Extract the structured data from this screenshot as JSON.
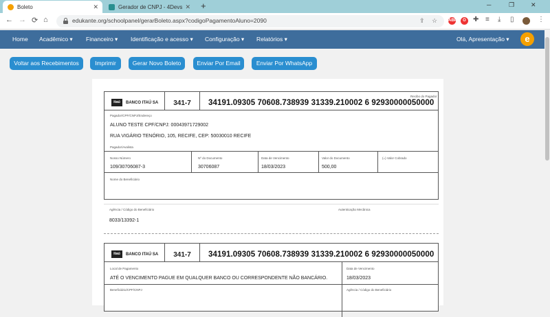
{
  "browser": {
    "tabs": [
      {
        "label": "Boleto",
        "active": true
      },
      {
        "label": "Gerador de CNPJ - 4Devs",
        "active": false
      }
    ],
    "new_tab": "+",
    "address": "edukante.org/schoolpanel/gerarBoleto.aspx?codigoPagamentoAluno=2090",
    "window_controls": {
      "minimize": "─",
      "restore": "❐",
      "close": "✕"
    },
    "extensions": {
      "adblock": "ABP",
      "opera": "O"
    }
  },
  "nav": {
    "items": [
      {
        "label": "Home"
      },
      {
        "label": "Acadêmico ▾"
      },
      {
        "label": "Financeiro ▾"
      },
      {
        "label": "Identificação e acesso ▾"
      },
      {
        "label": "Configuração ▾"
      },
      {
        "label": "Relatórios ▾"
      }
    ],
    "user": "Olá, Apresentação ▾",
    "logo_letter": "e"
  },
  "actions": [
    {
      "label": "Voltar aos Recebimentos"
    },
    {
      "label": "Imprimir"
    },
    {
      "label": "Gerar Novo Boleto"
    },
    {
      "label": "Enviar Por Email"
    },
    {
      "label": "Enviar Por WhatsApp"
    }
  ],
  "boleto": {
    "logo_text": "itaú",
    "bank_name": "BANCO ITAÚ SA",
    "bank_code": "341-7",
    "linha_digitavel": "34191.09305  70608.738939  31339.210002  6  92930000050000",
    "recibo_label": "Recibo do Pagador",
    "pagador_label": "Pagador/CPF/CNPJ/Endereço",
    "pagador_nome": "ALUNO TESTE  CPF/CNPJ: 00043971729002",
    "pagador_endereco": "RUA VIGÁRIO TENÓRIO, 105, RECIFE, CEP: 50030010 RECIFE",
    "avalista_label": "Pagador/Avalista",
    "fields": [
      {
        "label": "Nosso Número",
        "value": "109/30706087-3"
      },
      {
        "label": "Nº do Documento",
        "value": "30706087"
      },
      {
        "label": "Data de Vencimento",
        "value": "18/03/2023"
      },
      {
        "label": "Valor do Documento",
        "value": "500,00"
      },
      {
        "label": "(=) Valor Cobrado",
        "value": ""
      }
    ],
    "beneficiario_label": "Nome do Beneficiário",
    "agencia_label": "Agência / Código do Beneficiário",
    "agencia_value": "8033/13392-1",
    "autenticacao_label": "Autenticação Mecânica",
    "local_label": "Local de Pagamento",
    "local_value": "ATÉ O VENCIMENTO PAGUE EM QUALQUER BANCO OU CORRESPONDENTE NÃO BANCÁRIO.",
    "vencimento_label": "Data de Vencimento",
    "vencimento_value": "18/03/2023",
    "beneficiario2_label": "Beneficiário/CPF/CNPJ",
    "agencia2_label": "Agência / Código do Beneficiário"
  },
  "colors": {
    "nav": "#3e6d9c",
    "button": "#2a8ed0",
    "brand": "#f5a000"
  }
}
